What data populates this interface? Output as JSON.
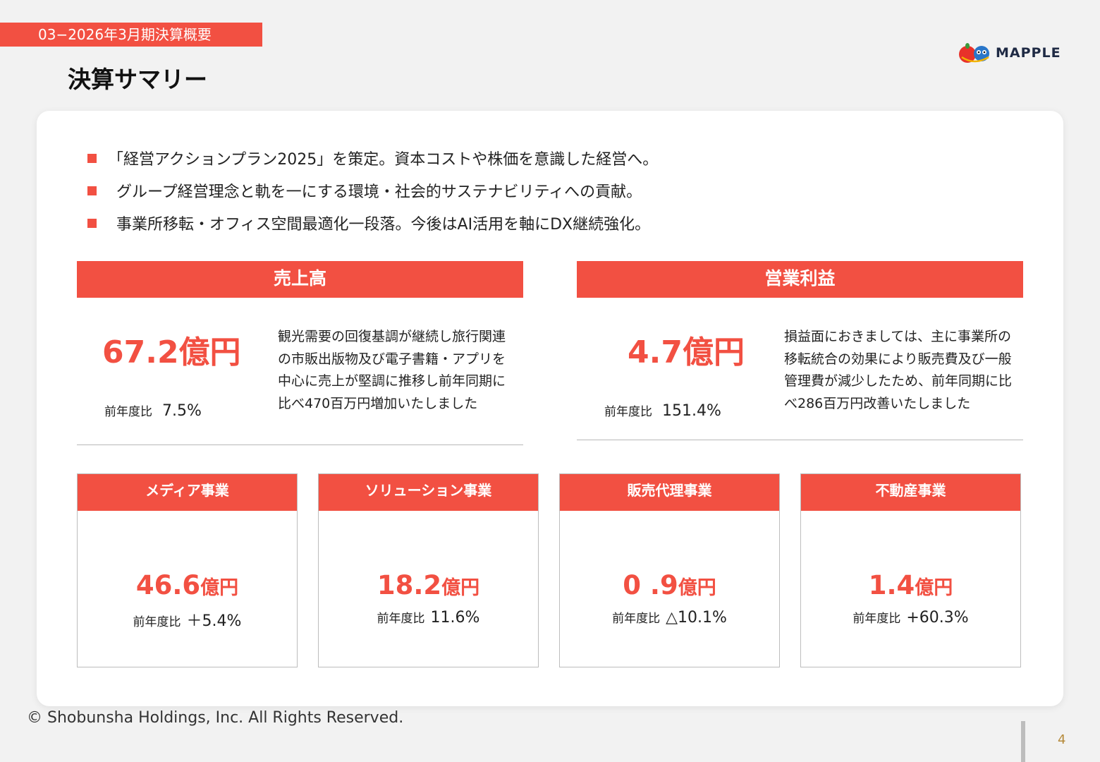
{
  "header": {
    "section_tag": "03−2026年3月期決算概要",
    "title": "決算サマリー",
    "logo_text": "MAPPLE"
  },
  "bullets": [
    "「経営アクションプラン2025」を策定。資本コストや株価を意識した経営へ。",
    "グループ経営理念と軌を一にする環境・社会的サステナビリティへの貢献。",
    "事業所移転・オフィス空間最適化一段落。今後はAI活用を軸にDX継続強化。"
  ],
  "sales": {
    "heading": "売上高",
    "value": "67.2億円",
    "yoy_label": "前年度比",
    "yoy_value": "7.5%",
    "description": "観光需要の回復基調が継続し旅行関連の市販出版物及び電子書籍・アプリを中心に売上が堅調に推移し前年同期に比べ470百万円増加いたしました"
  },
  "operating_profit": {
    "heading": "営業利益",
    "value": "4.7億円",
    "yoy_label": "前年度比",
    "yoy_value": "151.4%",
    "description": "損益面におきましては、主に事業所の移転統合の効果により販売費及び一般管理費が減少したため、前年同期に比べ286百万円改善いたしました"
  },
  "segments": [
    {
      "heading": "メディア事業",
      "value": "46.6",
      "unit": "億円",
      "yoy_label": "前年度比",
      "yoy_value": "＋5.4%"
    },
    {
      "heading": "ソリューション事業",
      "value": "18.2",
      "unit": "億円",
      "yoy_label": "前年度比",
      "yoy_value": "11.6%"
    },
    {
      "heading": "販売代理事業",
      "value": "0 .9",
      "unit": "億円",
      "yoy_label": "前年度比",
      "yoy_value": "△10.1%"
    },
    {
      "heading": "不動産事業",
      "value": "1.4",
      "unit": "億円",
      "yoy_label": "前年度比",
      "yoy_value": "+60.3%"
    }
  ],
  "footer": {
    "copyright": "© Shobunsha Holdings, Inc. All Rights Reserved.",
    "page_number": "4"
  },
  "colors": {
    "accent": "#f25042",
    "background": "#f2f2f2",
    "card": "#ffffff"
  }
}
